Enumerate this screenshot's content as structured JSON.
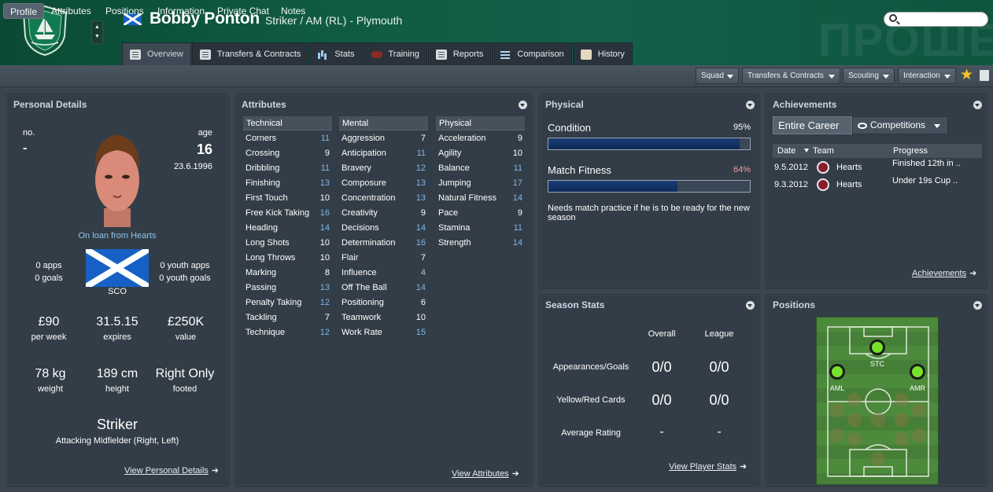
{
  "player": {
    "name": "Bobby Ponton",
    "position_club": "Striker / AM (RL) - Plymouth"
  },
  "background_watermark": "ПРОШЕ",
  "main_tabs": [
    {
      "label": "Overview",
      "icon": "card-icon",
      "active": true
    },
    {
      "label": "Transfers & Contracts",
      "icon": "document-icon"
    },
    {
      "label": "Stats",
      "icon": "bar-chart-icon"
    },
    {
      "label": "Training",
      "icon": "rugby-ball-icon"
    },
    {
      "label": "Reports",
      "icon": "document-icon"
    },
    {
      "label": "Comparison",
      "icon": "compare-lines-icon"
    },
    {
      "label": "History",
      "icon": "card-icon"
    }
  ],
  "sub_tabs": [
    "Profile",
    "Attributes",
    "Positions",
    "Information",
    "Private Chat",
    "Notes"
  ],
  "dropdowns": [
    "Squad",
    "Transfers & Contracts",
    "Scouting",
    "Interaction"
  ],
  "colors": {
    "header": "#0f5a41",
    "panel": "#333d47",
    "accent_blue": "#7fb7e8",
    "bar_fill": "#10295a",
    "position_green": "#76e22b",
    "star": "#f5c325",
    "fitness_pct": "#f29a9a"
  },
  "personal": {
    "title": "Personal Details",
    "no_label": "no.",
    "no_value": "-",
    "age_label": "age",
    "age_value": "16",
    "dob": "23.6.1996",
    "loan": "On loan from Hearts",
    "apps": "0 apps",
    "goals": "0 goals",
    "youth_apps": "0 youth apps",
    "youth_goals": "0 youth goals",
    "nation": "SCO",
    "wage": "£90",
    "wage_label": "per week",
    "expires": "31.5.15",
    "expires_label": "expires",
    "value": "£250K",
    "value_label": "value",
    "weight": "78 kg",
    "weight_label": "weight",
    "height": "189 cm",
    "height_label": "height",
    "footed": "Right Only",
    "footed_label": "footed",
    "role": "Striker",
    "role_sub": "Attacking Midfielder (Right, Left)",
    "link": "View Personal Details"
  },
  "attributes": {
    "title": "Attributes",
    "link": "View Attributes",
    "technical": {
      "head": "Technical",
      "rows": [
        [
          "Corners",
          "11"
        ],
        [
          "Crossing",
          "9"
        ],
        [
          "Dribbling",
          "11"
        ],
        [
          "Finishing",
          "13"
        ],
        [
          "First Touch",
          "10"
        ],
        [
          "Free Kick Taking",
          "16"
        ],
        [
          "Heading",
          "14"
        ],
        [
          "Long Shots",
          "10"
        ],
        [
          "Long Throws",
          "10"
        ],
        [
          "Marking",
          "8"
        ],
        [
          "Passing",
          "13"
        ],
        [
          "Penalty Taking",
          "12"
        ],
        [
          "Tackling",
          "7"
        ],
        [
          "Technique",
          "12"
        ]
      ]
    },
    "mental": {
      "head": "Mental",
      "rows": [
        [
          "Aggression",
          "7"
        ],
        [
          "Anticipation",
          "11"
        ],
        [
          "Bravery",
          "12"
        ],
        [
          "Composure",
          "13"
        ],
        [
          "Concentration",
          "13"
        ],
        [
          "Creativity",
          "9"
        ],
        [
          "Decisions",
          "14"
        ],
        [
          "Determination",
          "16"
        ],
        [
          "Flair",
          "7"
        ],
        [
          "Influence",
          "4"
        ],
        [
          "Off The Ball",
          "14"
        ],
        [
          "Positioning",
          "6"
        ],
        [
          "Teamwork",
          "10"
        ],
        [
          "Work Rate",
          "15"
        ]
      ]
    },
    "physical": {
      "head": "Physical",
      "rows": [
        [
          "Acceleration",
          "9"
        ],
        [
          "Agility",
          "10"
        ],
        [
          "Balance",
          "11"
        ],
        [
          "Jumping",
          "17"
        ],
        [
          "Natural Fitness",
          "14"
        ],
        [
          "Pace",
          "9"
        ],
        [
          "Stamina",
          "11"
        ],
        [
          "Strength",
          "14"
        ]
      ]
    }
  },
  "physical_panel": {
    "title": "Physical",
    "condition_label": "Condition",
    "condition_value": "95%",
    "condition_fraction": 0.95,
    "fitness_label": "Match Fitness",
    "fitness_value": "64%",
    "fitness_fraction": 0.64,
    "note": "Needs match practice if he is to be ready for the new season"
  },
  "achievements": {
    "title": "Achievements",
    "filter_label": "Entire Career",
    "competitions_label": "Competitions",
    "headers": [
      "Date",
      "Team",
      "Progress"
    ],
    "rows": [
      {
        "date": "9.5.2012",
        "team": "Hearts",
        "progress": "Finished 12th in .."
      },
      {
        "date": "9.3.2012",
        "team": "Hearts",
        "progress": "Under 19s Cup .."
      }
    ],
    "link": "Achievements"
  },
  "season_stats": {
    "title": "Season Stats",
    "col_overall": "Overall",
    "col_league": "League",
    "rows": [
      {
        "label": "Appearances/Goals",
        "overall": "0/0",
        "league": "0/0"
      },
      {
        "label": "Yellow/Red Cards",
        "overall": "0/0",
        "league": "0/0"
      },
      {
        "label": "Average Rating",
        "overall": "-",
        "league": "-"
      }
    ],
    "link": "View Player Stats"
  },
  "positions": {
    "title": "Positions",
    "labels": {
      "stc": "STC",
      "aml": "AML",
      "amr": "AMR"
    }
  }
}
